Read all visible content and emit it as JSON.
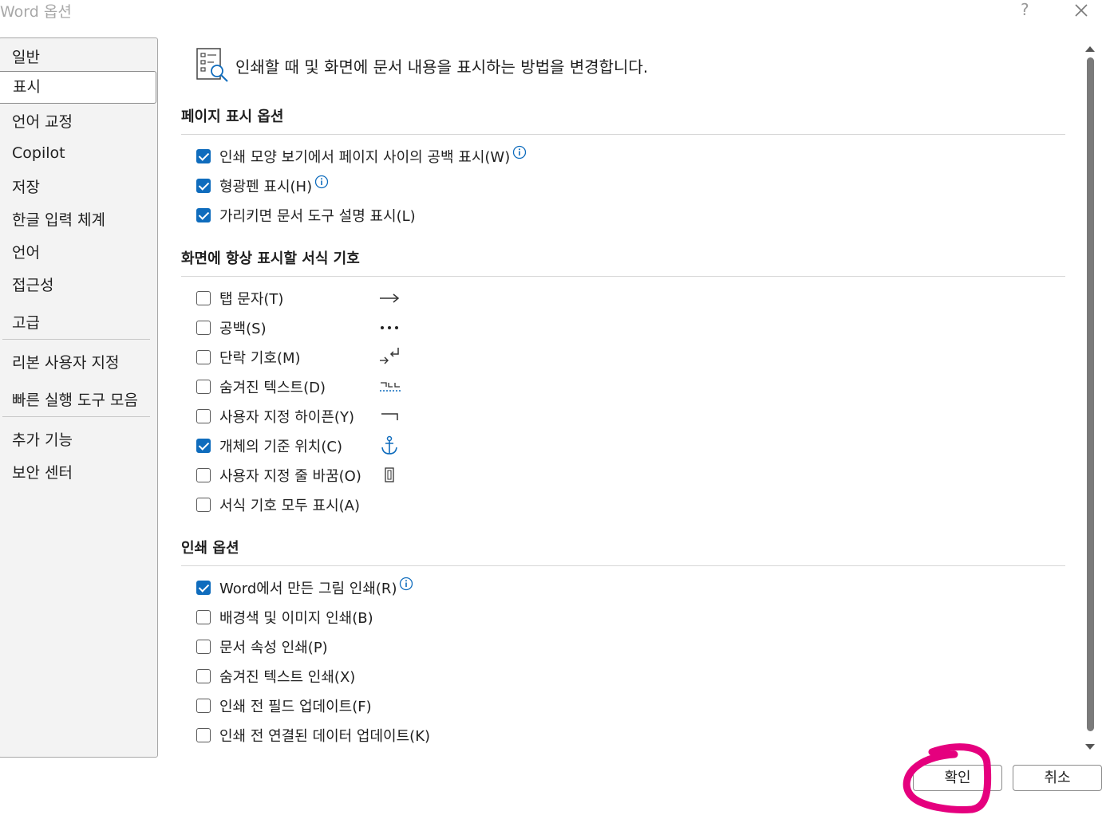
{
  "window": {
    "title": "Word 옵션",
    "help_label": "?"
  },
  "sidebar": {
    "items": [
      {
        "label": "일반"
      },
      {
        "label": "표시",
        "selected": true
      },
      {
        "label": "언어 교정"
      },
      {
        "label": "Copilot"
      },
      {
        "label": "저장"
      },
      {
        "label": "한글 입력 체계"
      },
      {
        "label": "언어"
      },
      {
        "label": "접근성"
      },
      {
        "label": "고급"
      },
      {
        "label": "리본 사용자 지정"
      },
      {
        "label": "빠른 실행 도구 모음"
      },
      {
        "label": "추가 기능"
      },
      {
        "label": "보안 센터"
      }
    ]
  },
  "header": {
    "description": "인쇄할 때 및 화면에 문서 내용을 표시하는 방법을 변경합니다.",
    "icon": "display-options-icon"
  },
  "sections": {
    "page_display": {
      "title": "페이지 표시 옵션",
      "options": [
        {
          "label": "인쇄 모양 보기에서 페이지 사이의 공백 표시(W)",
          "checked": true,
          "info": true
        },
        {
          "label": "형광펜 표시(H)",
          "checked": true,
          "info": true
        },
        {
          "label": "가리키면 문서 도구 설명 표시(L)",
          "checked": true
        }
      ]
    },
    "formatting_marks": {
      "title": "화면에 항상 표시할 서식 기호",
      "options": [
        {
          "label": "탭 문자(T)",
          "checked": false,
          "symbol": "tab-arrow-icon"
        },
        {
          "label": "공백(S)",
          "checked": false,
          "symbol": "space-dots-icon"
        },
        {
          "label": "단락 기호(M)",
          "checked": false,
          "symbol": "paragraph-mark-icon"
        },
        {
          "label": "숨겨진 텍스트(D)",
          "checked": false,
          "symbol": "hidden-text-icon"
        },
        {
          "label": "사용자 지정 하이픈(Y)",
          "checked": false,
          "symbol": "optional-hyphen-icon"
        },
        {
          "label": "개체의 기준 위치(C)",
          "checked": true,
          "symbol": "anchor-icon"
        },
        {
          "label": "사용자 지정 줄 바꿈(O)",
          "checked": false,
          "symbol": "line-break-icon"
        },
        {
          "label": "서식 기호 모두 표시(A)",
          "checked": false
        }
      ]
    },
    "print": {
      "title": "인쇄 옵션",
      "options": [
        {
          "label": "Word에서 만든 그림 인쇄(R)",
          "checked": true,
          "info": true
        },
        {
          "label": "배경색 및 이미지 인쇄(B)",
          "checked": false
        },
        {
          "label": "문서 속성 인쇄(P)",
          "checked": false
        },
        {
          "label": "숨겨진 텍스트 인쇄(X)",
          "checked": false
        },
        {
          "label": "인쇄 전 필드 업데이트(F)",
          "checked": false
        },
        {
          "label": "인쇄 전 연결된 데이터 업데이트(K)",
          "checked": false
        }
      ]
    }
  },
  "buttons": {
    "ok": "확인",
    "cancel": "취소"
  },
  "colors": {
    "accent": "#0f6cbd",
    "annotation": "#e5007e"
  }
}
